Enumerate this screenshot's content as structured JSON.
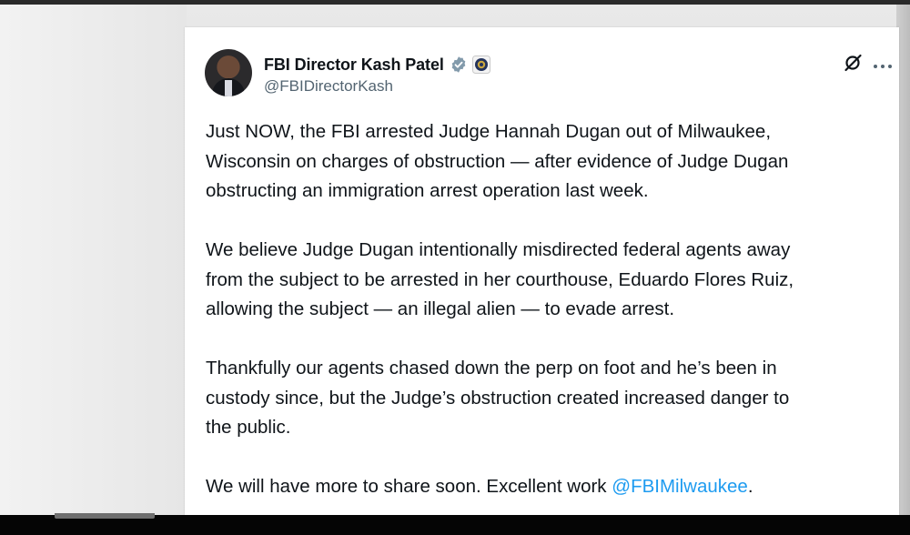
{
  "post": {
    "author": {
      "display_name": "FBI Director Kash Patel",
      "handle": "@FBIDirectorKash",
      "verified_badge_color": "#829aab"
    },
    "paragraphs": [
      {
        "lines": [
          "Just NOW, the FBI arrested Judge Hannah Dugan out of Milwaukee,",
          "Wisconsin on charges of obstruction — after evidence of Judge Dugan",
          "obstructing an immigration arrest operation last week."
        ]
      },
      {
        "lines": [
          "We believe Judge Dugan intentionally misdirected federal agents away",
          "from the subject to be arrested in her courthouse, Eduardo Flores Ruiz,",
          "allowing the subject — an illegal alien — to evade arrest."
        ]
      },
      {
        "lines": [
          "Thankfully our agents chased down the perp on foot and he’s been in",
          "custody since, but the Judge’s obstruction created increased danger to",
          "the public."
        ]
      },
      {
        "text_before_mention": "We will have more to share soon. Excellent work ",
        "mention": "@FBIMilwaukee",
        "text_after_mention": "."
      }
    ],
    "icons": {
      "verified": "verified-badge-icon",
      "affiliation": "fbi-seal-icon",
      "grok": "grok-icon",
      "more": "more-options-icon"
    },
    "colors": {
      "text": "#0f1419",
      "secondary_text": "#536471",
      "link": "#1d9bf0"
    }
  }
}
